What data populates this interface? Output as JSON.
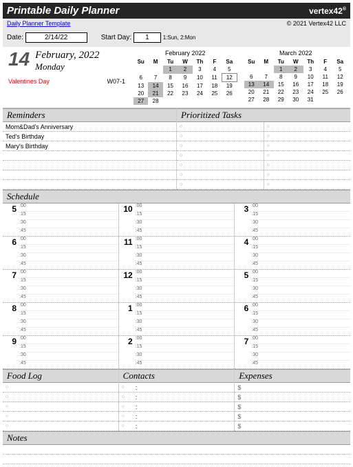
{
  "header": {
    "title": "Printable Daily Planner",
    "brand": "vertex42",
    "link": "Daily Planner Template",
    "copy": "© 2021 Vertex42 LLC"
  },
  "ctrl": {
    "date_lbl": "Date:",
    "date_val": "2/14/22",
    "sd_lbl": "Start Day:",
    "sd_val": "1",
    "sd_hint": "1:Sun, 2:Mon"
  },
  "day": {
    "num": "14",
    "my": "February, 2022",
    "dow": "Monday",
    "hol": "Valentines Day",
    "wk": "W07-1"
  },
  "cal1": {
    "title": "February 2022",
    "dow": [
      "Su",
      "M",
      "Tu",
      "W",
      "Th",
      "F",
      "Sa"
    ],
    "rows": [
      [
        "",
        "",
        "1",
        "2",
        "3",
        "4",
        "5"
      ],
      [
        "6",
        "7",
        "8",
        "9",
        "10",
        "11",
        "12"
      ],
      [
        "13",
        "14",
        "15",
        "16",
        "17",
        "18",
        "19"
      ],
      [
        "20",
        "21",
        "22",
        "23",
        "24",
        "25",
        "26"
      ],
      [
        "27",
        "28",
        "",
        "",
        "",
        "",
        ""
      ]
    ],
    "hl": [
      [
        0,
        2
      ],
      [
        0,
        3
      ],
      [
        2,
        1
      ],
      [
        3,
        1
      ],
      [
        4,
        0
      ]
    ],
    "box": [
      [
        1,
        6
      ]
    ]
  },
  "cal2": {
    "title": "March 2022",
    "dow": [
      "Su",
      "M",
      "Tu",
      "W",
      "Th",
      "F",
      "Sa"
    ],
    "rows": [
      [
        "",
        "",
        "1",
        "2",
        "3",
        "4",
        "5"
      ],
      [
        "6",
        "7",
        "8",
        "9",
        "10",
        "11",
        "12"
      ],
      [
        "13",
        "14",
        "15",
        "16",
        "17",
        "18",
        "19"
      ],
      [
        "20",
        "21",
        "22",
        "23",
        "24",
        "25",
        "26"
      ],
      [
        "27",
        "28",
        "29",
        "30",
        "31",
        "",
        ""
      ]
    ],
    "hl": [
      [
        0,
        2
      ],
      [
        0,
        3
      ],
      [
        2,
        0
      ],
      [
        2,
        1
      ]
    ]
  },
  "sec": {
    "rem": "Reminders",
    "pri": "Prioritized Tasks",
    "sch": "Schedule",
    "food": "Food Log",
    "con": "Contacts",
    "exp": "Expenses",
    "notes": "Notes"
  },
  "reminders": [
    "Mom&Dad's Anniversary",
    "Ted's Birthday",
    "Mary's Birthday",
    "",
    "",
    "",
    ""
  ],
  "tasks_cols": 2,
  "tasks_rows": 7,
  "sched_cols": [
    [
      "5",
      "6",
      "7",
      "8",
      "9"
    ],
    [
      "10",
      "11",
      "12",
      "1",
      "2"
    ],
    [
      "3",
      "4",
      "5",
      "6",
      "7"
    ]
  ],
  "mins": [
    ":00",
    ":15",
    ":30",
    ":45"
  ],
  "food_rows": 5,
  "con_rows": 5,
  "exp_rows": 5,
  "cur": "$",
  "notes_rows": 2
}
